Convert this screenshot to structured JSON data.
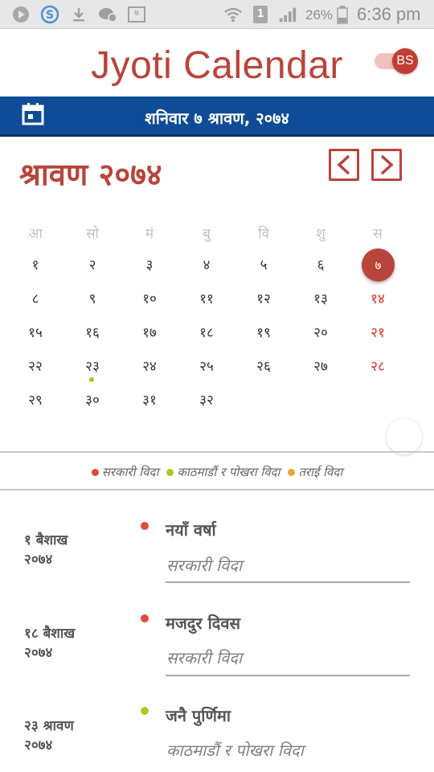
{
  "status_bar": {
    "icons": [
      "play-store-icon",
      "skype-icon",
      "download-icon",
      "chat-bubble-icon",
      "calendar-notif-icon",
      "wifi-icon",
      "sim-icon",
      "signal-icon",
      "battery-icon"
    ],
    "sim_label": "1",
    "notif_calendar_glyph": "७",
    "battery_percent": "26%",
    "time": "6:36 pm"
  },
  "header": {
    "title": "Jyoti Calendar",
    "toggle_label": "BS",
    "accent_color": "#b9443a"
  },
  "date_bar": {
    "icon": "calendar-icon",
    "text": "शनिवार  ७ श्रावण, २०७४",
    "color": "#0f4c97"
  },
  "month": {
    "title": "श्रावण २०७४",
    "prev_label": "<",
    "next_label": ">"
  },
  "weekdays": [
    "आ",
    "सो",
    "मं",
    "बु",
    "वि",
    "शु",
    "स"
  ],
  "calendar_rows": [
    [
      "१",
      "२",
      "३",
      "४",
      "५",
      "६",
      "७"
    ],
    [
      "८",
      "९",
      "१०",
      "११",
      "१२",
      "१३",
      "१४"
    ],
    [
      "१५",
      "१६",
      "१७",
      "१८",
      "१९",
      "२०",
      "२१"
    ],
    [
      "२२",
      "२३",
      "२४",
      "२५",
      "२६",
      "२७",
      "२८"
    ],
    [
      "२९",
      "३०",
      "३१",
      "३२",
      "",
      "",
      ""
    ]
  ],
  "today": "७",
  "legend": [
    {
      "label": "सरकारी विदा",
      "color": "#e04a38"
    },
    {
      "label": "काठमाडौं र पोखरा विदा",
      "color": "#b6c51c"
    },
    {
      "label": "तराई विदा",
      "color": "#f0a030"
    }
  ],
  "events": [
    {
      "date_line1": "१ बैशाख",
      "date_line2": "२०७४",
      "title": "नयाँ वर्षा",
      "type": "सरकारी विदा",
      "color": "#e04a38"
    },
    {
      "date_line1": "१८ बैशाख",
      "date_line2": "२०७४",
      "title": "मजदुर दिवस",
      "type": "सरकारी विदा",
      "color": "#e04a38"
    },
    {
      "date_line1": "२३ श्रावण",
      "date_line2": "२०७४",
      "title": "जनै पुर्णिमा",
      "type": "काठमाडौं र पोखरा विदा",
      "color": "#b6c51c"
    }
  ]
}
